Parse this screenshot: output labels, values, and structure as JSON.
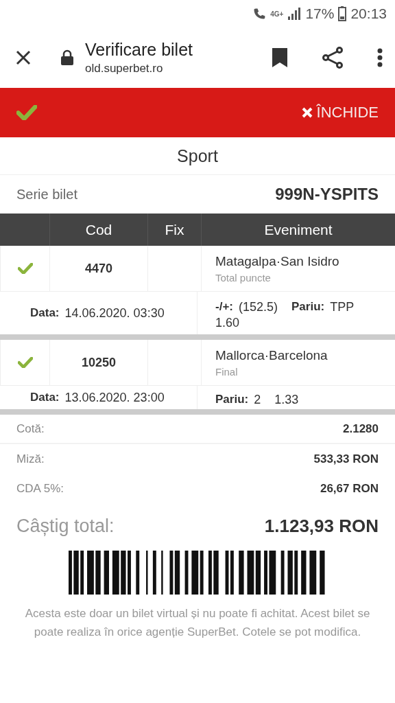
{
  "status_bar": {
    "network": "4G+",
    "battery": "17%",
    "time": "20:13"
  },
  "browser": {
    "title": "Verificare bilet",
    "url": "old.superbet.ro"
  },
  "banner": {
    "verified": true,
    "close_label": "ÎNCHIDE"
  },
  "ticket": {
    "section": "Sport",
    "serial_label": "Serie bilet",
    "serial": "999N-YSPITS",
    "columns": [
      "Cod",
      "Fix",
      "Eveniment"
    ],
    "events": [
      {
        "won": true,
        "code": "4470",
        "name": "Matagalpa·San Isidro",
        "market": "Total puncte",
        "date_label": "Data:",
        "date": "14.06.2020. 03:30",
        "bet": [
          {
            "label": "-/+:",
            "value": "(152.5)"
          },
          {
            "label": "Pariu:",
            "value": "TPP"
          }
        ],
        "odds": "1.60"
      },
      {
        "won": true,
        "code": "10250",
        "name": "Mallorca·Barcelona",
        "market": "Final",
        "date_label": "Data:",
        "date": "13.06.2020. 23:00",
        "bet": [
          {
            "label": "Pariu:",
            "value": "2"
          }
        ],
        "odds": "1.33"
      }
    ],
    "summary": [
      {
        "label": "Cotă:",
        "value": "2.1280",
        "divider": true
      },
      {
        "label": "Miză:",
        "value": "533,33 RON",
        "divider": false
      },
      {
        "label": "CDA 5%:",
        "value": "26,67 RON",
        "divider": false
      }
    ],
    "total_label": "Câștig total:",
    "total": "1.123,93 RON",
    "note": "Acesta este doar un bilet virtual și nu poate fi achitat. Acest bilet se poate realiza în orice agenție SuperBet. Cotele se pot modifica."
  }
}
